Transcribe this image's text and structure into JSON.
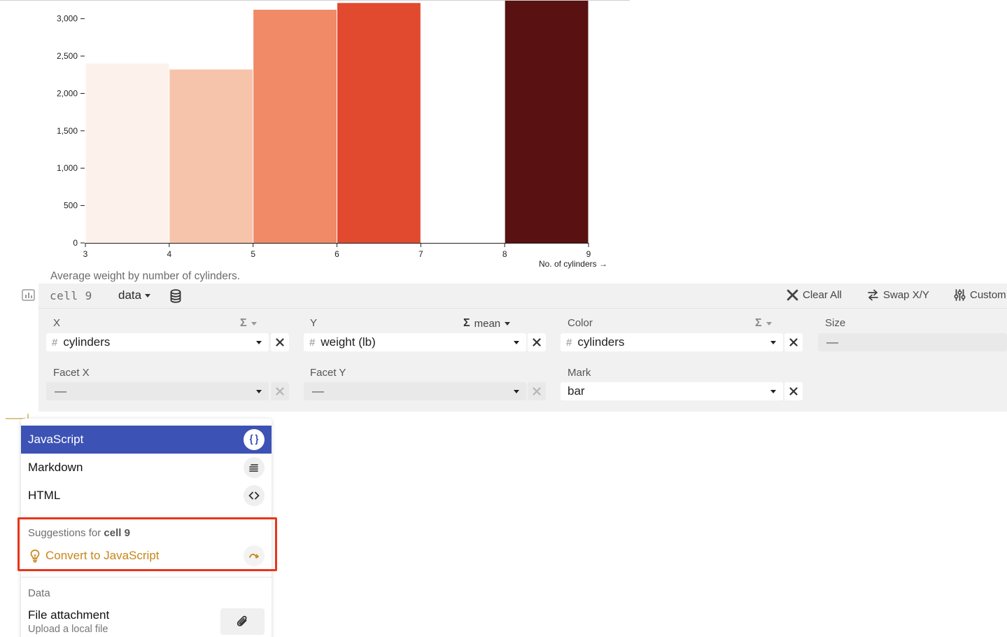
{
  "chart_data": {
    "type": "bar",
    "title": "",
    "caption": "Average weight by number of cylinders.",
    "xlabel": "No. of cylinders →",
    "ylabel": "",
    "xlim": [
      3,
      9
    ],
    "ylim": [
      0,
      3250
    ],
    "x_ticks": [
      "3",
      "4",
      "5",
      "6",
      "7",
      "8",
      "9"
    ],
    "y_ticks": [
      "0",
      "500",
      "1,000",
      "1,500",
      "2,000",
      "2,500",
      "3,000"
    ],
    "x_tick_values": [
      3,
      4,
      5,
      6,
      7,
      8,
      9
    ],
    "y_tick_values": [
      0,
      500,
      1000,
      1500,
      2000,
      2500,
      3000
    ],
    "bars": [
      {
        "x0": 3,
        "x1": 4,
        "value": 2400,
        "color": "#fcf1eb"
      },
      {
        "x0": 4,
        "x1": 5,
        "value": 2320,
        "color": "#f6c4ab"
      },
      {
        "x0": 5,
        "x1": 6,
        "value": 3120,
        "color": "#f08a67"
      },
      {
        "x0": 6,
        "x1": 7,
        "value": 3210,
        "color": "#e24a30"
      },
      {
        "x0": 8,
        "x1": 9,
        "value": 3250,
        "color": "#5a1111"
      }
    ],
    "grid": false
  },
  "cell_toolbar": {
    "cell_name": "cell 9",
    "data_label": "data",
    "clear_all": "Clear All",
    "swap": "Swap X/Y",
    "customize": "Custom"
  },
  "config": {
    "x": {
      "label": "X",
      "value": "cylinders"
    },
    "y": {
      "label": "Y",
      "reduce": "mean",
      "value": "weight (lb)"
    },
    "color": {
      "label": "Color",
      "value": "cylinders"
    },
    "size": {
      "label": "Size",
      "value": "—"
    },
    "facet_x": {
      "label": "Facet X",
      "value": "—"
    },
    "facet_y": {
      "label": "Facet Y",
      "value": "—"
    },
    "mark": {
      "label": "Mark",
      "value": "bar"
    },
    "sigma": "Σ"
  },
  "menu": {
    "items": [
      {
        "label": "JavaScript",
        "icon": "braces-icon",
        "active": true
      },
      {
        "label": "Markdown",
        "icon": "text-lines-icon",
        "active": false
      },
      {
        "label": "HTML",
        "icon": "angle-brackets-icon",
        "active": false
      }
    ],
    "suggestions_prefix": "Suggestions for",
    "suggestions_cell": "cell 9",
    "suggestion": "Convert to JavaScript",
    "data_heading": "Data",
    "file_title": "File attachment",
    "file_subtitle": "Upload a local file"
  },
  "colors": {
    "menu_active": "#3c52b4",
    "suggestion": "#c8861a",
    "highlight_border": "#e8351b"
  }
}
